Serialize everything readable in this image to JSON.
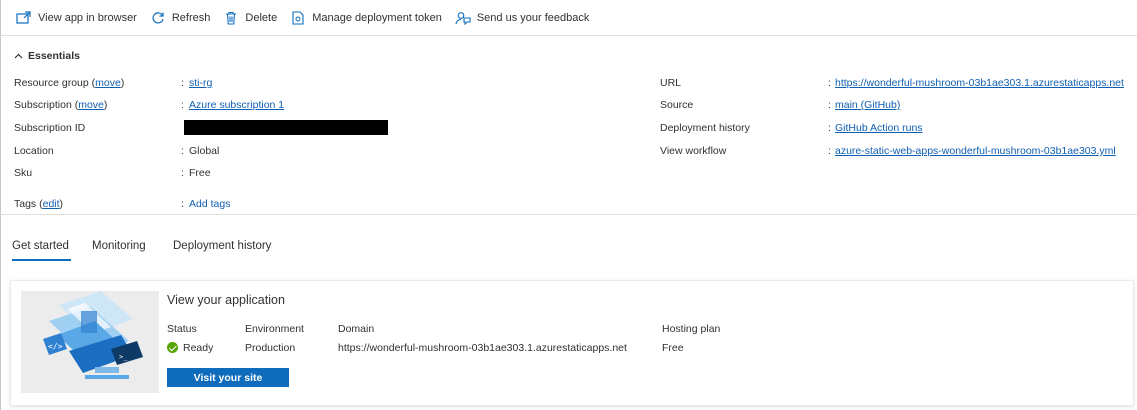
{
  "toolbar": {
    "view_app": "View app in browser",
    "refresh": "Refresh",
    "delete": "Delete",
    "manage_token": "Manage deployment token",
    "feedback": "Send us your feedback"
  },
  "essentials": {
    "title": "Essentials",
    "left": {
      "resource_group_label": "Resource group",
      "move_link": "move",
      "resource_group_value": "sti-rg",
      "subscription_label": "Subscription",
      "subscription_value": "Azure subscription 1",
      "subscription_id_label": "Subscription ID",
      "location_label": "Location",
      "location_value": "Global",
      "sku_label": "Sku",
      "sku_value": "Free",
      "tags_label": "Tags",
      "edit_link": "edit",
      "tags_value": "Add tags"
    },
    "right": {
      "url_label": "URL",
      "url_value": "https://wonderful-mushroom-03b1ae303.1.azurestaticapps.net",
      "source_label": "Source",
      "source_value": "main (GitHub)",
      "deploy_history_label": "Deployment history",
      "deploy_history_value": "GitHub Action runs",
      "workflow_label": "View workflow",
      "workflow_value": "azure-static-web-apps-wonderful-mushroom-03b1ae303.yml"
    }
  },
  "tabs": [
    {
      "label": "Get started",
      "active": true
    },
    {
      "label": "Monitoring",
      "active": false
    },
    {
      "label": "Deployment history",
      "active": false
    }
  ],
  "card": {
    "title": "View your application",
    "status_header": "Status",
    "status_value": "Ready",
    "environment_header": "Environment",
    "environment_value": "Production",
    "domain_header": "Domain",
    "domain_value": "https://wonderful-mushroom-03b1ae303.1.azurestaticapps.net",
    "hosting_header": "Hosting plan",
    "hosting_value": "Free",
    "button_label": "Visit your site"
  },
  "colors": {
    "link": "#0f5fb3",
    "primary": "#0f6cbd",
    "success": "#57a300"
  },
  "icons": [
    "open-in-browser-icon",
    "refresh-icon",
    "delete-icon",
    "token-icon",
    "feedback-icon",
    "chevron-up-icon",
    "status-ok-icon",
    "app-illustration"
  ]
}
